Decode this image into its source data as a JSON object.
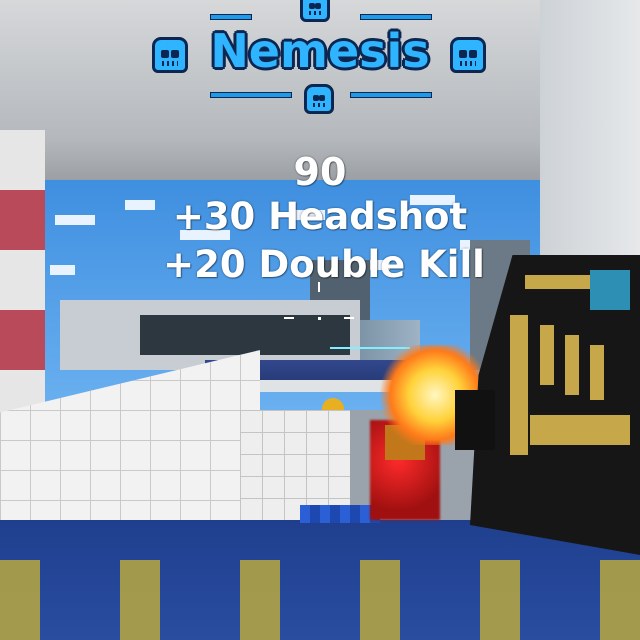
{
  "hud": {
    "achievement_title": "Nemesis",
    "score_total": "90",
    "bonus_lines": [
      "+30 Headshot",
      "+20 Double Kill"
    ]
  },
  "icons": {
    "banner": [
      "skull-icon",
      "skull-icon",
      "skull-icon",
      "skull-icon"
    ],
    "crosshair": "crosshair-icon"
  },
  "colors": {
    "title_fill": "#2fb4ff",
    "title_outline": "#0b2650",
    "score_text": "#ffffff",
    "floor": "#1f3f8e",
    "enemy": "#ff2a2a",
    "muzzle_flash": "#ffd23a"
  }
}
